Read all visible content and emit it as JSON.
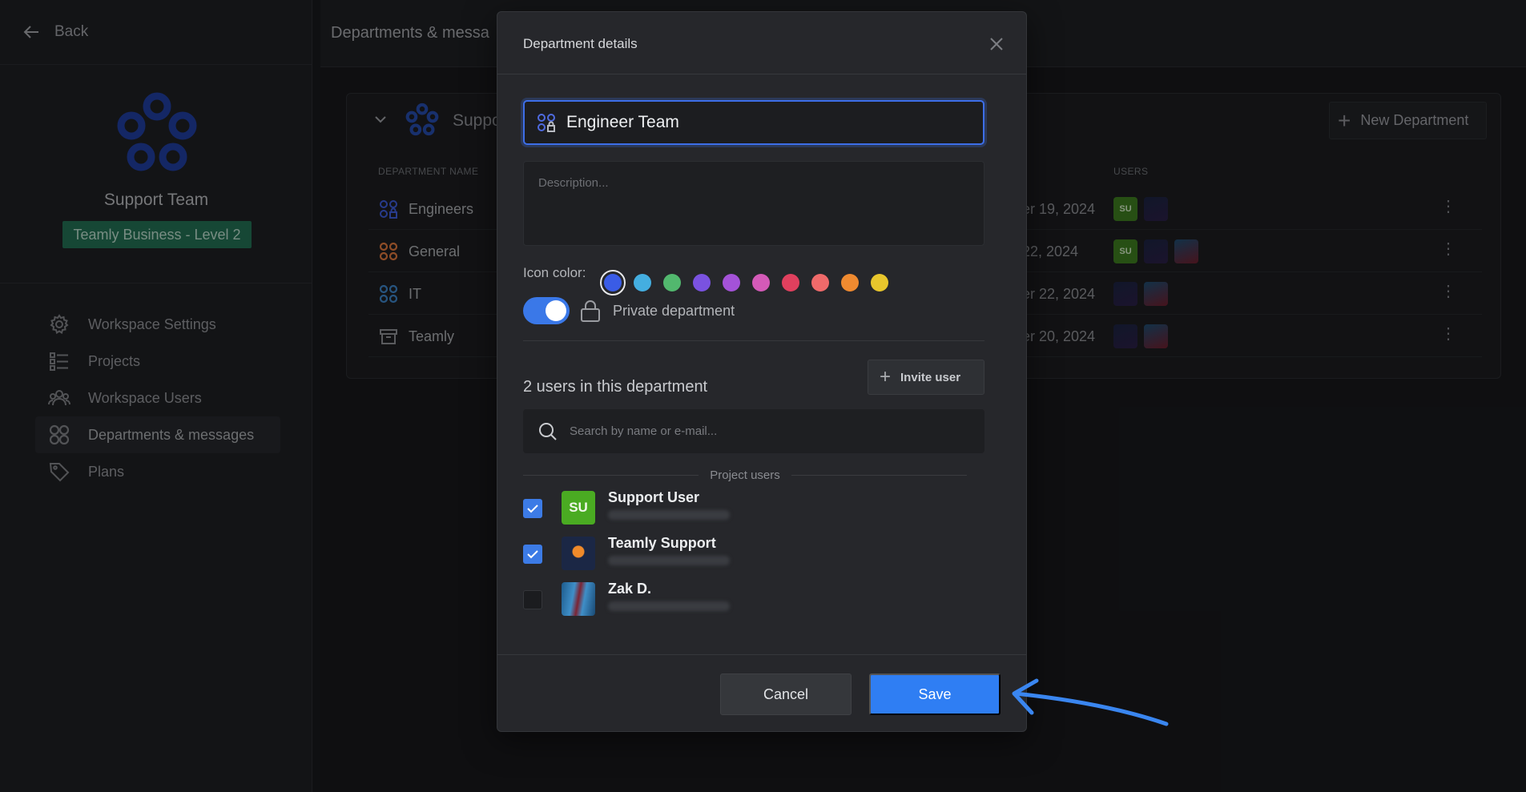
{
  "sidebar": {
    "back_label": "Back",
    "workspace_name": "Support Team",
    "plan_badge": "Teamly Business - Level 2",
    "nav": [
      {
        "label": "Workspace Settings",
        "icon": "gear-icon"
      },
      {
        "label": "Projects",
        "icon": "list-icon"
      },
      {
        "label": "Workspace Users",
        "icon": "users-icon"
      },
      {
        "label": "Departments & messages",
        "icon": "grid-icon",
        "active": true
      },
      {
        "label": "Plans",
        "icon": "tag-icon"
      }
    ]
  },
  "header": {
    "breadcrumb": "Departments & messa"
  },
  "departments_card": {
    "title": "Suppo",
    "new_department_label": "New Department",
    "col_name": "DEPARTMENT NAME",
    "col_users": "USERS",
    "rows": [
      {
        "name": "Engineers",
        "date": "er 19, 2024",
        "icon_color": "#3d5bd6"
      },
      {
        "name": "General",
        "date": "22, 2024",
        "icon_color": "#d9753c"
      },
      {
        "name": "IT",
        "date": "er 22, 2024",
        "icon_color": "#3d82c4"
      },
      {
        "name": "Teamly",
        "date": "er 20, 2024",
        "icon_color": "#8a8c91"
      }
    ],
    "user_avatar_initials": "SU"
  },
  "modal": {
    "title": "Department details",
    "name_value": "Engineer Team",
    "description_placeholder": "Description...",
    "icon_color_label": "Icon color:",
    "colors": [
      "#3a5ce6",
      "#44aee0",
      "#52b86e",
      "#7a52e0",
      "#a452d8",
      "#d45ab8",
      "#e0405e",
      "#ef6a6a",
      "#ef8a30",
      "#e8c62c"
    ],
    "selected_color": "#3a5ce6",
    "private_label": "Private department",
    "private_enabled": true,
    "users_count_label": "2 users in this department",
    "invite_label": "Invite user",
    "search_placeholder": "Search by name or e-mail...",
    "section_label": "Project users",
    "users": [
      {
        "name": "Support User",
        "initials": "SU",
        "checked": true
      },
      {
        "name": "Teamly Support",
        "initials": "",
        "checked": true
      },
      {
        "name": "Zak D.",
        "initials": "",
        "checked": false
      }
    ],
    "cancel_label": "Cancel",
    "save_label": "Save"
  },
  "colors": {
    "accent": "#2f7ef3",
    "plan_badge": "#226e52"
  }
}
